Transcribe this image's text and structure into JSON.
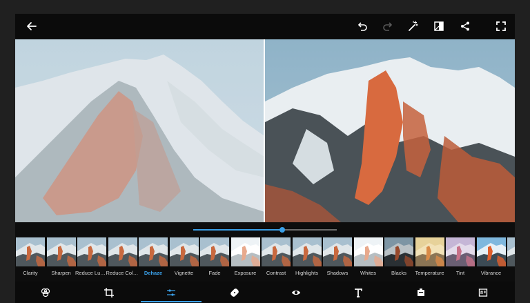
{
  "toolbar": {
    "icons": [
      "back-arrow-icon",
      "undo-icon",
      "redo-icon",
      "magic-wand-icon",
      "compare-icon",
      "share-icon",
      "fullscreen-icon"
    ]
  },
  "colors": {
    "accent": "#3aa0e8",
    "toolbar_bg": "#0b0b0b",
    "icon": "#ffffff",
    "icon_disabled": "#5a5a5a"
  },
  "adjustment": {
    "active": "Dehaze",
    "value_fraction": 0.62
  },
  "thumbnails": [
    {
      "label": "Clarity",
      "tint": "none"
    },
    {
      "label": "Sharpen",
      "tint": "none"
    },
    {
      "label": "Reduce Lum...",
      "tint": "none"
    },
    {
      "label": "Reduce Colo...",
      "tint": "none"
    },
    {
      "label": "Dehaze",
      "tint": "none",
      "active": true
    },
    {
      "label": "Vignette",
      "tint": "none"
    },
    {
      "label": "Fade",
      "tint": "none"
    },
    {
      "label": "Exposure",
      "tint": "bright"
    },
    {
      "label": "Contrast",
      "tint": "none"
    },
    {
      "label": "Highlights",
      "tint": "none"
    },
    {
      "label": "Shadows",
      "tint": "none"
    },
    {
      "label": "Whites",
      "tint": "bright"
    },
    {
      "label": "Blacks",
      "tint": "dark"
    },
    {
      "label": "Temperature",
      "tint": "warm"
    },
    {
      "label": "Tint",
      "tint": "purple"
    },
    {
      "label": "Vibrance",
      "tint": "vivid"
    },
    {
      "label": "S",
      "tint": "none"
    }
  ],
  "bottom_nav": {
    "icons": [
      "looks-icon",
      "crop-icon",
      "adjustments-icon",
      "heal-icon",
      "eye-icon",
      "text-icon",
      "sticker-icon",
      "export-icon"
    ],
    "active": "adjustments-icon"
  }
}
